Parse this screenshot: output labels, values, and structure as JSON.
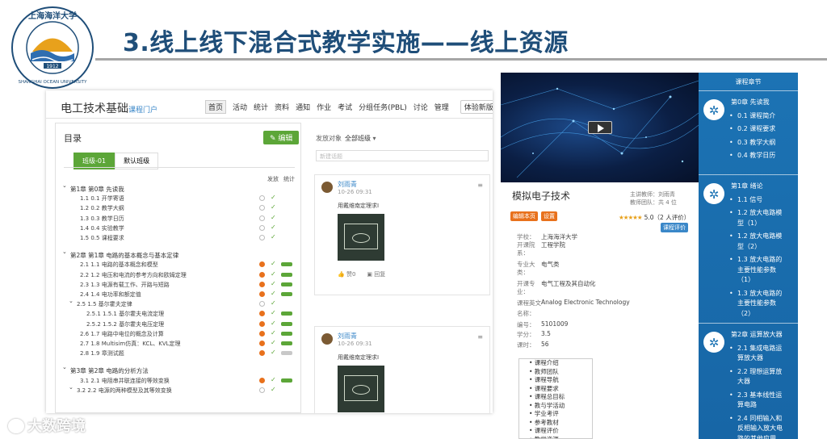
{
  "slide": {
    "title": "3.线上线下混合式教学实施——线上资源",
    "logo_text_top": "上海海洋大学",
    "logo_text_bottom": "SHANGHAI OCEAN UNIVERSITY",
    "logo_year": "1912"
  },
  "left_panel": {
    "course_title": "电工技术基础",
    "course_sub": "课程门户",
    "nav": [
      "首页",
      "活动",
      "统计",
      "资料",
      "通知",
      "作业",
      "考试",
      "分组任务(PBL)",
      "讨论",
      "管理"
    ],
    "nav_active": "首页",
    "experience_label": "体验新版",
    "catalog_title": "目录",
    "edit_label": "编辑",
    "class_tabs": [
      "班级-01",
      "默认班级"
    ],
    "col_heads": [
      "发放",
      "统计"
    ],
    "rows": [
      {
        "text": "第1章 第0章 先读我",
        "type": "chapter",
        "circle": "none"
      },
      {
        "text": "1.1  0.1 开学寄语",
        "type": "item",
        "circle": "empty"
      },
      {
        "text": "1.2  0.2 教学大纲",
        "type": "item",
        "circle": "empty"
      },
      {
        "text": "1.3  0.3 教学日历",
        "type": "item",
        "circle": "empty"
      },
      {
        "text": "1.4  0.4 实验教学",
        "type": "item",
        "circle": "empty"
      },
      {
        "text": "1.5  0.5 课程要求",
        "type": "item",
        "circle": "empty"
      },
      {
        "text": "第2章 第1章 电路的基本概念与基本定律",
        "type": "chapter",
        "circle": "none"
      },
      {
        "text": "2.1  1.1 电路的基本概念和模型",
        "type": "item",
        "circle": "orange",
        "bar": "green"
      },
      {
        "text": "2.2  1.2 电压和电流的参考方向和欧姆定理",
        "type": "item",
        "circle": "orange",
        "bar": "green"
      },
      {
        "text": "2.3  1.3 电源有载工作、开路与短路",
        "type": "item",
        "circle": "orange",
        "bar": "green"
      },
      {
        "text": "2.4  1.4 电功率和额定值",
        "type": "item",
        "circle": "orange",
        "bar": "green"
      },
      {
        "text": "2.5  1.5 基尔霍夫定律",
        "type": "sub",
        "circle": "empty"
      },
      {
        "text": "2.5.1  1.5.1 基尔霍夫电流定理",
        "type": "subsub",
        "circle": "orange",
        "bar": "green"
      },
      {
        "text": "2.5.2  1.5.2 基尔霍夫电压定理",
        "type": "subsub",
        "circle": "orange",
        "bar": "green"
      },
      {
        "text": "2.6  1.7 电路中电位的概念及计算",
        "type": "item",
        "circle": "orange",
        "bar": "green"
      },
      {
        "text": "2.7  1.8 Multisim仿真：KCL、KVL定理",
        "type": "item",
        "circle": "orange",
        "bar": "green"
      },
      {
        "text": "2.8  1.9 章测试题",
        "type": "item",
        "circle": "orange",
        "bar": "grey"
      },
      {
        "text": "第3章 第2章 电路的分析方法",
        "type": "chapter",
        "circle": "none"
      },
      {
        "text": "3.1  2.1 电阻串并联连接的等效变换",
        "type": "item",
        "circle": "orange",
        "bar": "green"
      },
      {
        "text": "3.2  2.2 电源的两种模型及其等效变换",
        "type": "sub",
        "circle": "empty"
      }
    ],
    "discussion": {
      "target_label": "发放对象",
      "target_value": "全部班级",
      "new_post_placeholder": "新建话题",
      "posts": [
        {
          "name": "刘雨青",
          "time": "10-26 09:31",
          "body": "用戴维南定理求I",
          "like": "赞0",
          "reply": "回复"
        },
        {
          "name": "刘雨青",
          "time": "10-26 09:31",
          "body": "用戴维南定理求I"
        }
      ]
    }
  },
  "info_panel": {
    "title": "模拟电子技术",
    "teacher_line1": "主讲教师：刘雨青",
    "teacher_line2": "教师团队：共 4 位",
    "badges": [
      "编辑本页",
      "设置"
    ],
    "stars": "★★★★★",
    "score": "5.0（2 人评价）",
    "review_btn": "课程评价",
    "fields": [
      {
        "k": "学校：",
        "v": "上海海洋大学"
      },
      {
        "k": "开课院",
        "v": "工程学院"
      },
      {
        "k": "系：",
        "v": ""
      },
      {
        "k": "专业大",
        "v": "电气类"
      },
      {
        "k": "类：",
        "v": ""
      },
      {
        "k": "开课专",
        "v": "电气工程及其自动化"
      },
      {
        "k": "业：",
        "v": ""
      },
      {
        "k": "课程英文",
        "v": "Analog Electronic Technology"
      },
      {
        "k": "名称：",
        "v": ""
      },
      {
        "k": "编号：",
        "v": "5101009"
      },
      {
        "k": "学分：",
        "v": "3.5"
      },
      {
        "k": "课时：",
        "v": "56"
      }
    ],
    "toc": [
      "• 课程介绍",
      "• 教师团队",
      "• 课程导航",
      "• 课程要求",
      "• 课程总目标",
      "• 教与学活动",
      "• 学业考评",
      "• 参考教材",
      "• 课程评价",
      "• 教学资源"
    ]
  },
  "chapters": {
    "heading": "课程章节",
    "groups": [
      {
        "lines": [
          {
            "t": "第0章 先读我",
            "b": false
          },
          {
            "t": "0.1 课程简介",
            "b": true
          },
          {
            "t": "0.2 课程要求",
            "b": true
          },
          {
            "t": "0.3 教学大纲",
            "b": true
          },
          {
            "t": "0.4 教学日历",
            "b": true
          }
        ]
      },
      {
        "lines": [
          {
            "t": "第1章 绪论",
            "b": false
          },
          {
            "t": "1.1 信号",
            "b": true
          },
          {
            "t": "1.2 放大电路模",
            "b": true
          },
          {
            "t": "型（1）",
            "b": false
          },
          {
            "t": "1.2 放大电路模",
            "b": true
          },
          {
            "t": "型（2）",
            "b": false
          },
          {
            "t": "1.3 放大电路的",
            "b": true
          },
          {
            "t": "主要性能参数",
            "b": false
          },
          {
            "t": "（1）",
            "b": false
          },
          {
            "t": "1.3 放大电路的",
            "b": true
          },
          {
            "t": "主要性能参数",
            "b": false
          },
          {
            "t": "（2）",
            "b": false
          }
        ]
      },
      {
        "lines": [
          {
            "t": "第2章 运算放大器",
            "b": false
          },
          {
            "t": "2.1 集成电路运",
            "b": true
          },
          {
            "t": "算放大器",
            "b": false
          },
          {
            "t": "2.2 理想运算放",
            "b": true
          },
          {
            "t": "大器",
            "b": false
          },
          {
            "t": "2.3 基本线性运",
            "b": true
          },
          {
            "t": "算电路",
            "b": false
          },
          {
            "t": "2.4 同相输入和",
            "b": true
          },
          {
            "t": "反相输入放大电",
            "b": false
          },
          {
            "t": "路的其他应用",
            "b": false
          }
        ]
      }
    ]
  },
  "watermark": "大数跨境",
  "colors": {
    "title": "#1f4e79",
    "green": "#5ca638",
    "orange": "#e8711c",
    "blue": "#1c73b4"
  }
}
